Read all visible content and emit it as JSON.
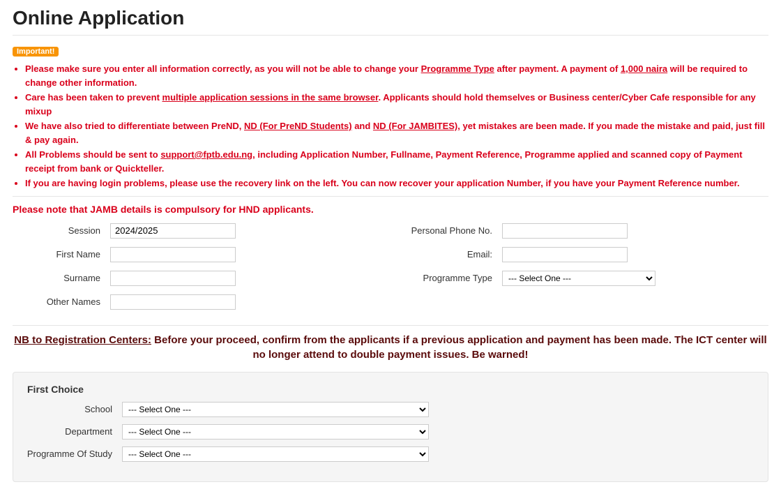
{
  "page_title": "Online Application",
  "important_badge": "Important!",
  "warnings": {
    "w1a": "Please make sure you enter all information correctly, as you will not be able to change your ",
    "w1b": "Programme Type",
    "w1c": " after payment. A payment of ",
    "w1d": "1,000 naira",
    "w1e": " will be required to change other information.",
    "w2a": "Care has been taken to prevent ",
    "w2b": "multiple application sessions in the same browser",
    "w2c": ". Applicants should hold themselves or Business center/Cyber Cafe responsible for any mixup",
    "w3a": "We have also tried to differentiate between PreND, ",
    "w3b": "ND (For PreND Students)",
    "w3c": " and ",
    "w3d": "ND (For JAMBITES)",
    "w3e": ", yet mistakes are been made. If you made the mistake and paid, just fill & pay again.",
    "w4a": "All Problems should be sent to ",
    "w4b": "support@fptb.edu.ng",
    "w4c": ", including Application Number, Fullname, Payment Reference, Programme applied and scanned copy of Payment receipt from bank or Quickteller.",
    "w5": "If you are having login problems, please use the recovery link on the left. You can now recover your application Number, if you have your Payment Reference number."
  },
  "jamb_note": "Please note that JAMB details is compulsory for HND applicants.",
  "labels": {
    "session": "Session",
    "first_name": "First Name",
    "surname": "Surname",
    "other_names": "Other Names",
    "phone": "Personal Phone No.",
    "email": "Email:",
    "programme_type": "Programme Type"
  },
  "values": {
    "session": "2024/2025",
    "first_name": "",
    "surname": "",
    "other_names": "",
    "phone": "",
    "email": "",
    "programme_type": "--- Select One ---"
  },
  "nb": {
    "lead": "NB to Registration Centers:",
    "rest": " Before your proceed, confirm from the applicants if a previous application and payment has been made. The ICT center will no longer attend to double payment issues. Be warned!"
  },
  "first_choice": {
    "heading": "First Choice",
    "school_label": "School",
    "school_value": "--- Select One ---",
    "dept_label": "Department",
    "dept_value": "--- Select One ---",
    "prog_label": "Programme Of Study",
    "prog_value": "--- Select One ---"
  }
}
